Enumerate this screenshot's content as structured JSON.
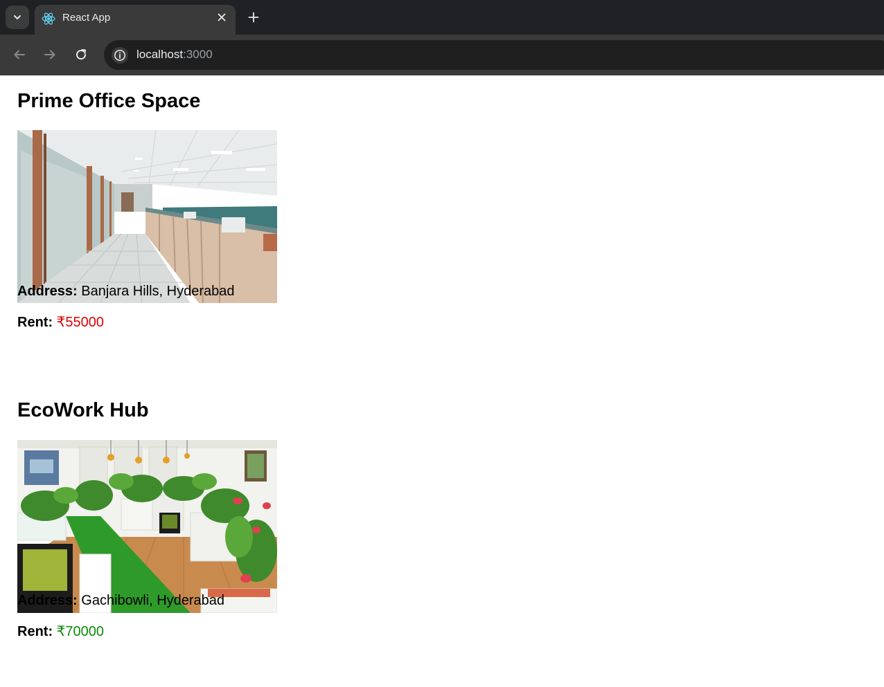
{
  "browser": {
    "tab_title": "React App",
    "url_host": "localhost",
    "url_port": ":3000"
  },
  "listings": [
    {
      "name": "Prime Office Space",
      "address_label": "Address:",
      "address": "Banjara Hills, Hyderabad",
      "rent_label": "Rent:",
      "rent": "₹55000",
      "rent_color": "#e00000"
    },
    {
      "name": "EcoWork Hub",
      "address_label": "Address:",
      "address": "Gachibowli, Hyderabad",
      "rent_label": "Rent:",
      "rent": "₹70000",
      "rent_color": "#0a8a0a"
    }
  ]
}
